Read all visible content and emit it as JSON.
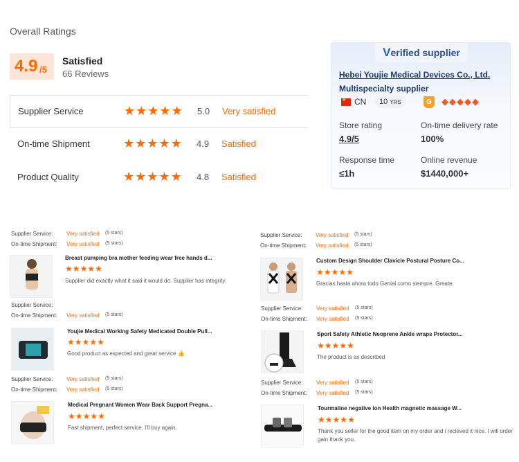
{
  "overall": {
    "title": "Overall Ratings",
    "score": "4.9",
    "score_suffix": "/5",
    "word": "Satisfied",
    "reviews": "66 Reviews"
  },
  "ratings": [
    {
      "label": "Supplier Service",
      "score": "5.0",
      "word": "Very satisfied"
    },
    {
      "label": "On-time Shipment",
      "score": "4.9",
      "word": "Satisfied"
    },
    {
      "label": "Product Quality",
      "score": "4.8",
      "word": "Satisfied"
    }
  ],
  "supplier": {
    "badge_v": "V",
    "badge_rest": "erified supplier",
    "company": "Hebei Youjie Medical Devices Co., Ltd.",
    "type": "Multispecialty supplier",
    "country": "CN",
    "years": "10",
    "years_unit": "YRS",
    "gold_mark": "G",
    "diamonds": [
      "◆",
      "◆",
      "◆",
      "◆",
      "◆"
    ],
    "store_rating_label": "Store rating",
    "store_rating_value": "4.9/5",
    "ontime_label": "On-time delivery rate",
    "ontime_value": "100%",
    "response_label": "Response time",
    "response_value": "≤1h",
    "revenue_label": "Online revenue",
    "revenue_value": "$1440,000+"
  },
  "review_labels": {
    "service": "Supplier Service:",
    "shipment": "On-time Shipment:",
    "very_satisfied": "Very satisfied",
    "five_stars": "(5 stars)"
  },
  "reviews": [
    {
      "title": "Breast pumping bra mother feeding wear free hands d...",
      "comment": "Supplier did exactly what it said it would do. Supplier has integrity.",
      "stars": [
        "★",
        "★",
        "★",
        "★",
        "★"
      ]
    },
    {
      "title": "Youjie Medical Working Safety Medicated Double Pull...",
      "comment": "Good product as expected and great service 👍",
      "stars": [
        "★",
        "★",
        "★",
        "★",
        "★"
      ]
    },
    {
      "title": "Medical Pregnant Women Wear Back Support Pregna...",
      "comment": "Fast shipment, perfect service. I'll buy again.",
      "stars": [
        "★",
        "★",
        "★",
        "★",
        "★"
      ]
    },
    {
      "title": "Custom Design Shoulder Clavicle Postural Posture Co...",
      "comment": "Gracias hasta ahora todo Genial como siempre. Greate.",
      "stars": [
        "★",
        "★",
        "★",
        "★",
        "★"
      ]
    },
    {
      "title": "Sport Safety Athletic Neoprene Ankle wraps Protector...",
      "comment": "The product is as described",
      "stars": [
        "★",
        "★",
        "★",
        "★",
        "★"
      ]
    },
    {
      "title": "Tourmaline negative ion Health magnetic massage W...",
      "comment": "Thank you seller for the good item on my order and i recieved it nice. I will order",
      "comment2": "gain thank you.",
      "stars": [
        "★",
        "★",
        "★",
        "★",
        "★"
      ]
    }
  ],
  "colors": {
    "accent": "#ff6a00",
    "navy": "#1a3a6a"
  }
}
